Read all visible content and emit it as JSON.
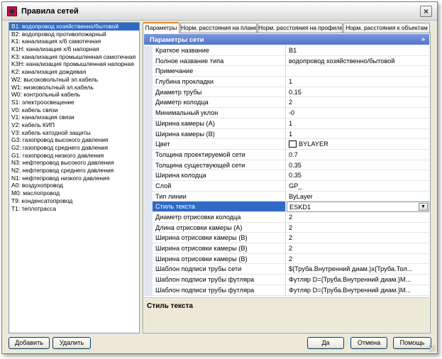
{
  "window": {
    "title": "Правила сетей"
  },
  "networks": [
    "B1: водопровод хозяйственно/бытовой",
    "B2: водопровод противопожарный",
    "K1: канализация х/б самотечная",
    "K1H: канализация х/б напорная",
    "K3: канализация промышленная самотечная",
    "K3H: канализация промышленная напорная",
    "K2: канализация дождевая",
    "W2: высоковольтный эл.кабель",
    "W1: низковольтный эл.кабель",
    "W0: контрольный кабель",
    "S1: электроосвещение",
    "V0: кабель связи",
    "V1: канализация связи",
    "V2: кабель КИП",
    "V3: кабель катодной защиты",
    "G3: газопровод высокого давления",
    "G2: газопровод среднего давления",
    "G1: газопровод низкого давления",
    "N3: нефтепровод высокого давления",
    "N2: нефтепровод среднего давления",
    "N1: нефтепровод низкого давления",
    "A0: воздухопровод",
    "M0: маслопровод",
    "T9: конденсатопровод",
    "T1: теплотрасса"
  ],
  "tabs": [
    "Параметры",
    "Норм. расстояния на плане",
    "Норм. расстояния на профиле",
    "Норм. расстояния к объектам"
  ],
  "section": {
    "title": "Параметры сети",
    "collapse_icon": "»"
  },
  "properties": [
    {
      "name": "Краткое название",
      "value": "B1"
    },
    {
      "name": "Полное название типа",
      "value": "водопровод хозяйственно/бытовой"
    },
    {
      "name": "Примечание",
      "value": ""
    },
    {
      "name": "Глубина прокладки",
      "value": "1"
    },
    {
      "name": "Диаметр трубы",
      "value": "0.15"
    },
    {
      "name": "Диаметр колодца",
      "value": "2"
    },
    {
      "name": "Минимальный уклон",
      "value": "-0"
    },
    {
      "name": "Ширина камеры (A)",
      "value": "1"
    },
    {
      "name": "Ширина камеры (B)",
      "value": "1"
    },
    {
      "name": "Цвет",
      "value": "BYLAYER"
    },
    {
      "name": "Толщина проектируемой сети",
      "value": "0.7"
    },
    {
      "name": "Толщина существующей сети",
      "value": "0.35"
    },
    {
      "name": "Ширина колодца",
      "value": "0.35"
    },
    {
      "name": "Слой",
      "value": "GP_"
    },
    {
      "name": "Тип линии",
      "value": "ByLayer"
    },
    {
      "name": "Стиль текста",
      "value": "ESKD1"
    },
    {
      "name": "Диаметр отрисовки колодца",
      "value": "2"
    },
    {
      "name": "Длина отрисовки камеры (A)",
      "value": "2"
    },
    {
      "name": "Ширина отрисовки камеры (B)",
      "value": "2"
    },
    {
      "name": "Ширина отрисовки камеры (B)",
      "value": "2"
    },
    {
      "name": "Ширина отрисовки камеры (B)",
      "value": "2"
    },
    {
      "name": "Шаблон подписи трубы сети",
      "value": "${Труба.Внутренний диам.}x{Труба.Тол..."
    },
    {
      "name": "Шаблон подписи трубы футляра",
      "value": "Футляр D={Труба.Внутренний диам.}M..."
    },
    {
      "name": "Шаблон подписи трубы футляра",
      "value": "Футляр D={Труба.Внутренний диам.}M..."
    }
  ],
  "help": {
    "title": "Стиль текста"
  },
  "buttons": {
    "add": "Добавить",
    "delete": "Удалить",
    "ok": "Да",
    "cancel": "Отмена",
    "help": "Помощь"
  },
  "icons": {
    "close": "close-icon",
    "dropdown": "chevron-down-icon",
    "collapse": "collapse-icon"
  }
}
